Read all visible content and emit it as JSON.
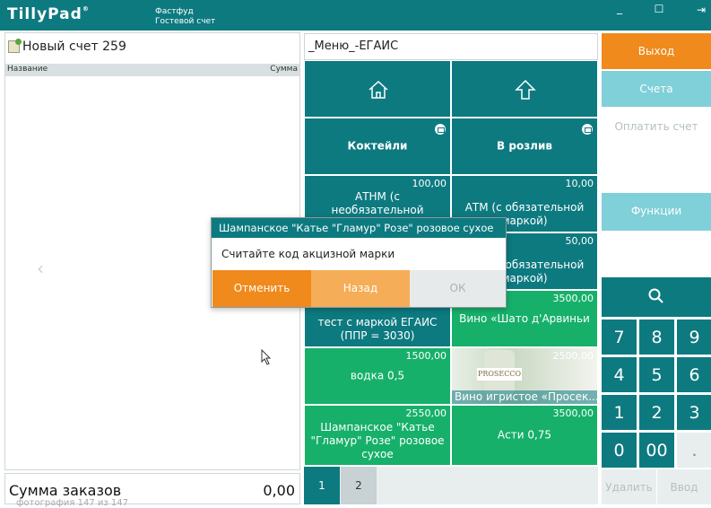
{
  "topbar": {
    "logo": "TillyPad",
    "title_line1": "Фастфуд",
    "title_line2": "Гостевой счет",
    "minimize_label": "_",
    "maximize_label": "☐",
    "exit_label": "⇥"
  },
  "order": {
    "title": "Новый счет 259",
    "col_name": "Название",
    "col_sum": "Сумма",
    "total_label": "Сумма заказов",
    "total_value": "0,00",
    "photo_caption": "фотография 147 из 147"
  },
  "menu": {
    "title": "_Меню_-ЕГАИС",
    "home_icon": "home-icon",
    "up_icon": "up-arrow-icon",
    "folders": [
      {
        "label": "Коктейли"
      },
      {
        "label": "В розлив"
      }
    ],
    "items": [
      {
        "price": "100,00",
        "name": "АТНМ (с необязательной"
      },
      {
        "price": "10,00",
        "name": "АТМ (с обязательной маркой)"
      },
      {
        "price": "",
        "name": ""
      },
      {
        "price": "50,00",
        "name": "АТМ (с обязательной маркой)"
      },
      {
        "price": "",
        "name": "тест с маркой ЕГАИС (ППР = 3030)"
      },
      {
        "price": "3500,00",
        "name": "Вино «Шато д'Арвиньи"
      },
      {
        "price": "1500,00",
        "name": "водка 0,5"
      },
      {
        "price": "2500,00",
        "name": "Вино игристое «Просек..."
      },
      {
        "price": "2550,00",
        "name": "Шампанское \"Катье \"Гламур\" Розе\" розовое сухое"
      },
      {
        "price": "3500,00",
        "name": "Асти 0,75"
      }
    ],
    "photo_brand": "PROSECCO",
    "pages": [
      "1",
      "2"
    ]
  },
  "actions": {
    "exit": "Выход",
    "bills": "Счета",
    "pay": "Оплатить счет",
    "functions": "Функции",
    "delete": "Удалить",
    "enter": "Ввод"
  },
  "keypad": [
    "7",
    "8",
    "9",
    "4",
    "5",
    "6",
    "1",
    "2",
    "3",
    "0",
    "00",
    "."
  ],
  "dialog": {
    "title": "Шампанское \"Катье \"Гламур\" Розе\" розовое сухое",
    "message": "Считайте код акцизной марки",
    "cancel": "Отменить",
    "back": "Назад",
    "ok": "ОК"
  },
  "colors": {
    "teal": "#0d7a80",
    "green": "#16b06a",
    "orange": "#f08a1c",
    "light_teal": "#7fd0d8"
  }
}
